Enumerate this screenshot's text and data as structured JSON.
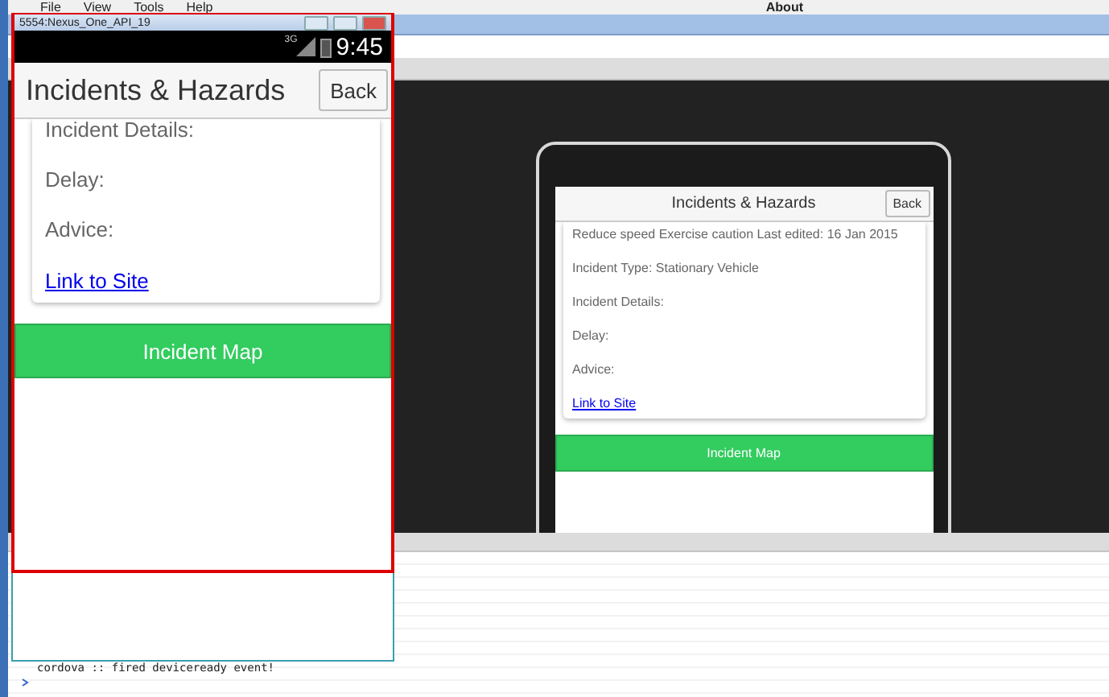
{
  "menu": [
    "File",
    "View",
    "Tools",
    "Help",
    "About"
  ],
  "emulator": {
    "title": "5554:Nexus_One_API_19",
    "network": "3G",
    "time": "9:45",
    "app": {
      "title": "Incidents & Hazards",
      "back": "Back",
      "fields": [
        "Incident Details:",
        "Delay:",
        "Advice:"
      ],
      "link": "Link to Site",
      "button": "Incident Map"
    }
  },
  "preview": {
    "app": {
      "title": "Incidents & Hazards",
      "back": "Back",
      "fields": [
        "Reduce speed Exercise caution Last edited: 16 Jan 2015",
        "Incident Type: Stationary Vehicle",
        "Incident Details:",
        "Delay:",
        "Advice:"
      ],
      "link": "Link to Site",
      "button": "Incident Map"
    }
  },
  "console": {
    "lines": [
      "cordova :: fired deviceready event!"
    ]
  }
}
